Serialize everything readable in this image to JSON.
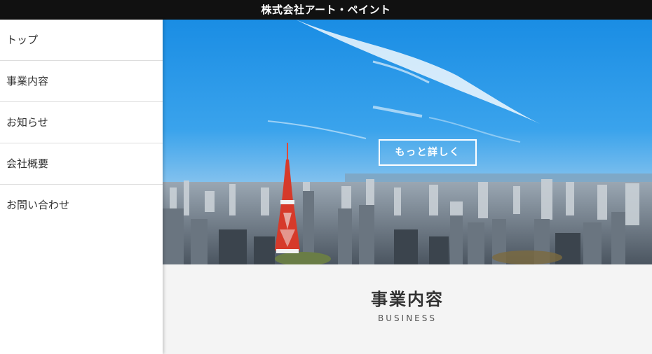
{
  "header": {
    "title": "株式会社アート・ペイント"
  },
  "sidebar": {
    "items": [
      {
        "label": "トップ"
      },
      {
        "label": "事業内容"
      },
      {
        "label": "お知らせ"
      },
      {
        "label": "会社概要"
      },
      {
        "label": "お問い合わせ"
      }
    ]
  },
  "hero": {
    "button_label": "もっと詳しく",
    "image": "tokyo-skyline-photo"
  },
  "section": {
    "title": "事業内容",
    "subtitle": "BUSINESS"
  },
  "colors": {
    "header_bg": "#111111",
    "sky_top": "#1b8fe6",
    "sky_bottom": "#8fc8f0",
    "section_bg": "#f4f4f4",
    "tower": "#d63a2a"
  }
}
